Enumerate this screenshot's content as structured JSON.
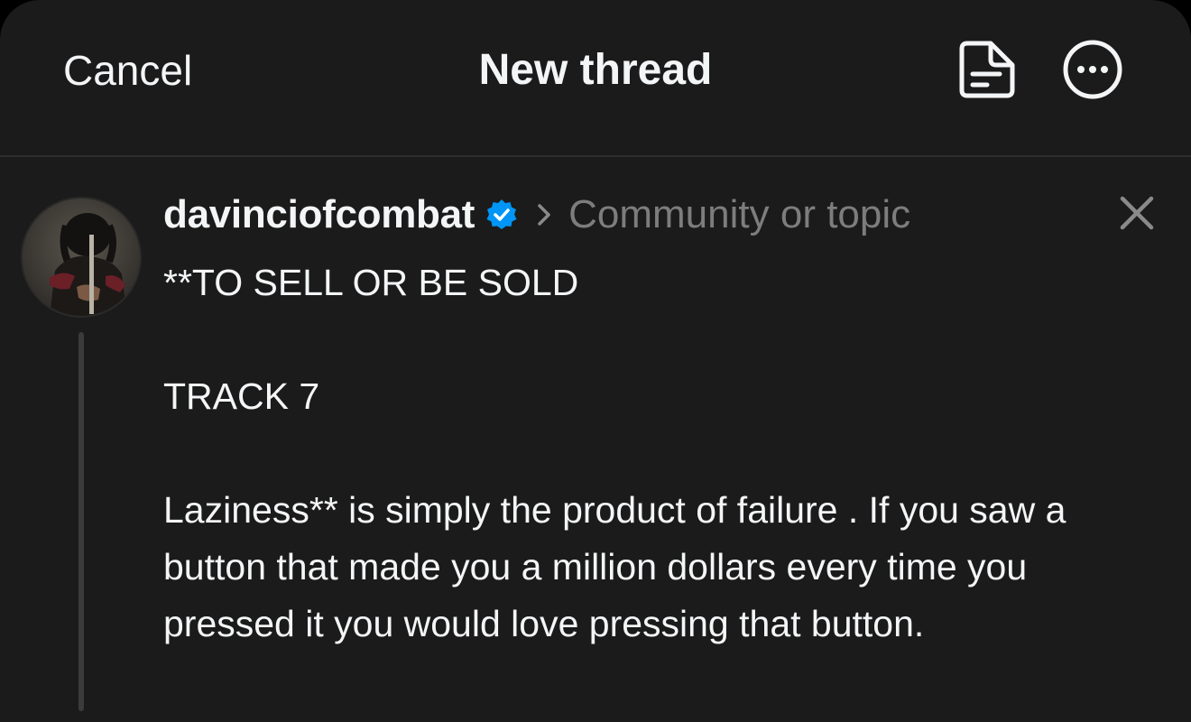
{
  "header": {
    "cancel_label": "Cancel",
    "title": "New thread",
    "drafts_icon": "drafts-icon",
    "more_icon": "more-options-icon"
  },
  "composer": {
    "username": "davinciofcombat",
    "verified": true,
    "topic_placeholder": "Community or topic",
    "body": [
      "**TO SELL OR BE SOLD",
      "TRACK 7",
      "Laziness** is simply the product of failure . If you saw a button that made you a million dollars every time you pressed it you would love pressing that button."
    ]
  },
  "colors": {
    "background": "#1b1b1b",
    "text": "#f3f5f7",
    "muted": "#7d7d7d",
    "verified_badge": "#0095f6",
    "divider": "#2e2e2e"
  }
}
